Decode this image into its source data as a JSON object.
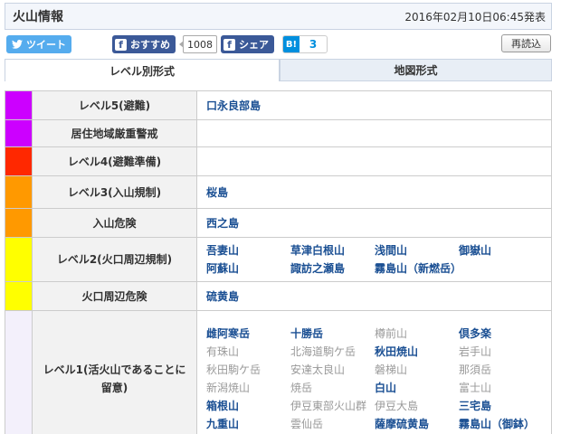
{
  "header": {
    "title": "火山情報",
    "updated": "2016年02月10日06:45発表"
  },
  "share": {
    "tweet_label": "ツイート",
    "fb_recommend_label": "おすすめ",
    "fb_recommend_count": "1008",
    "fb_share_label": "シェア",
    "hatena_label": "B!",
    "hatena_count": "3",
    "reload_label": "再読込"
  },
  "tabs": [
    {
      "label": "レベル別形式",
      "active": true
    },
    {
      "label": "地図形式",
      "active": false
    }
  ],
  "colors": {
    "level5": "#cc00ff",
    "level4": "#ff2800",
    "level3": "#ff9900",
    "level2": "#ffff00",
    "level1": "#f3f0fb",
    "link": "#1a4f93"
  },
  "rows": [
    {
      "label": "レベル5(避難)",
      "color": "#cc00ff",
      "volcanoes": [
        {
          "name": "口永良部島",
          "dim": false
        }
      ]
    },
    {
      "label": "居住地域厳重警戒",
      "color": "#cc00ff",
      "volcanoes": []
    },
    {
      "label": "レベル4(避難準備)",
      "color": "#ff2800",
      "volcanoes": []
    },
    {
      "label": "レベル3(入山規制)",
      "color": "#ff9900",
      "volcanoes": [
        {
          "name": "桜島",
          "dim": false
        }
      ]
    },
    {
      "label": "入山危険",
      "color": "#ff9900",
      "volcanoes": [
        {
          "name": "西之島",
          "dim": false
        }
      ]
    },
    {
      "label": "レベル2(火口周辺規制)",
      "color": "#ffff00",
      "volcanoes": [
        {
          "name": "吾妻山",
          "dim": false
        },
        {
          "name": "草津白根山",
          "dim": false
        },
        {
          "name": "浅間山",
          "dim": false
        },
        {
          "name": "御嶽山",
          "dim": false
        },
        {
          "name": "阿蘇山",
          "dim": false
        },
        {
          "name": "諏訪之瀬島",
          "dim": false
        },
        {
          "name": "霧島山（新燃岳）",
          "dim": false
        }
      ]
    },
    {
      "label": "火口周辺危険",
      "color": "#ffff00",
      "volcanoes": [
        {
          "name": "硫黄島",
          "dim": false
        }
      ]
    },
    {
      "label": "レベル1(活火山であることに留意)",
      "color": "#f3f0fb",
      "volcanoes": [
        {
          "name": "雌阿寒岳",
          "dim": false
        },
        {
          "name": "十勝岳",
          "dim": false
        },
        {
          "name": "樽前山",
          "dim": true
        },
        {
          "name": "倶多楽",
          "dim": false
        },
        {
          "name": "有珠山",
          "dim": true
        },
        {
          "name": "北海道駒ケ岳",
          "dim": true
        },
        {
          "name": "秋田焼山",
          "dim": false
        },
        {
          "name": "岩手山",
          "dim": true
        },
        {
          "name": "秋田駒ケ岳",
          "dim": true
        },
        {
          "name": "安達太良山",
          "dim": true
        },
        {
          "name": "磐梯山",
          "dim": true
        },
        {
          "name": "那須岳",
          "dim": true
        },
        {
          "name": "新潟焼山",
          "dim": true
        },
        {
          "name": "焼岳",
          "dim": true
        },
        {
          "name": "白山",
          "dim": false
        },
        {
          "name": "富士山",
          "dim": true
        },
        {
          "name": "箱根山",
          "dim": false
        },
        {
          "name": "伊豆東部火山群",
          "dim": true
        },
        {
          "name": "伊豆大島",
          "dim": true
        },
        {
          "name": "三宅島",
          "dim": false
        },
        {
          "name": "九重山",
          "dim": false
        },
        {
          "name": "雲仙岳",
          "dim": true
        },
        {
          "name": "薩摩硫黄島",
          "dim": false
        },
        {
          "name": "霧島山（御鉢）",
          "dim": false
        }
      ]
    }
  ]
}
